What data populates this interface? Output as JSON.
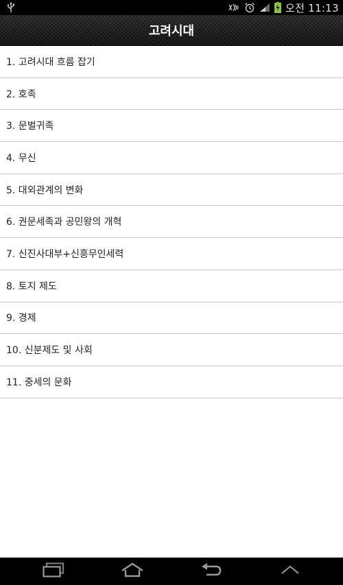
{
  "status_bar": {
    "icons": [
      "usb-icon",
      "nfc-icon",
      "alarm-icon",
      "signal-icon",
      "battery-icon"
    ],
    "time": "오전 11:13"
  },
  "header": {
    "title": "고려시대"
  },
  "chapters": [
    "1. 고려시대 흐름 잡기",
    "2. 호족",
    "3. 문벌귀족",
    "4. 무신",
    "5. 대외관계의 변화",
    "6. 권문세족과 공민왕의 개혁",
    "7. 신진사대부+신흥무인세력",
    "8. 토지 제도",
    "9. 경제",
    "10. 신분제도 및 사회",
    "11. 중세의 문화"
  ],
  "nav_bar": {
    "buttons": [
      "recent-apps-icon",
      "home-icon",
      "back-icon",
      "menu-up-icon"
    ]
  },
  "colors": {
    "status_bar_bg": "#000000",
    "title_bar_bg": "#1c1c1c",
    "list_bg": "#ffffff",
    "divider": "#c8c8c8",
    "battery_green": "#8bc34a"
  }
}
